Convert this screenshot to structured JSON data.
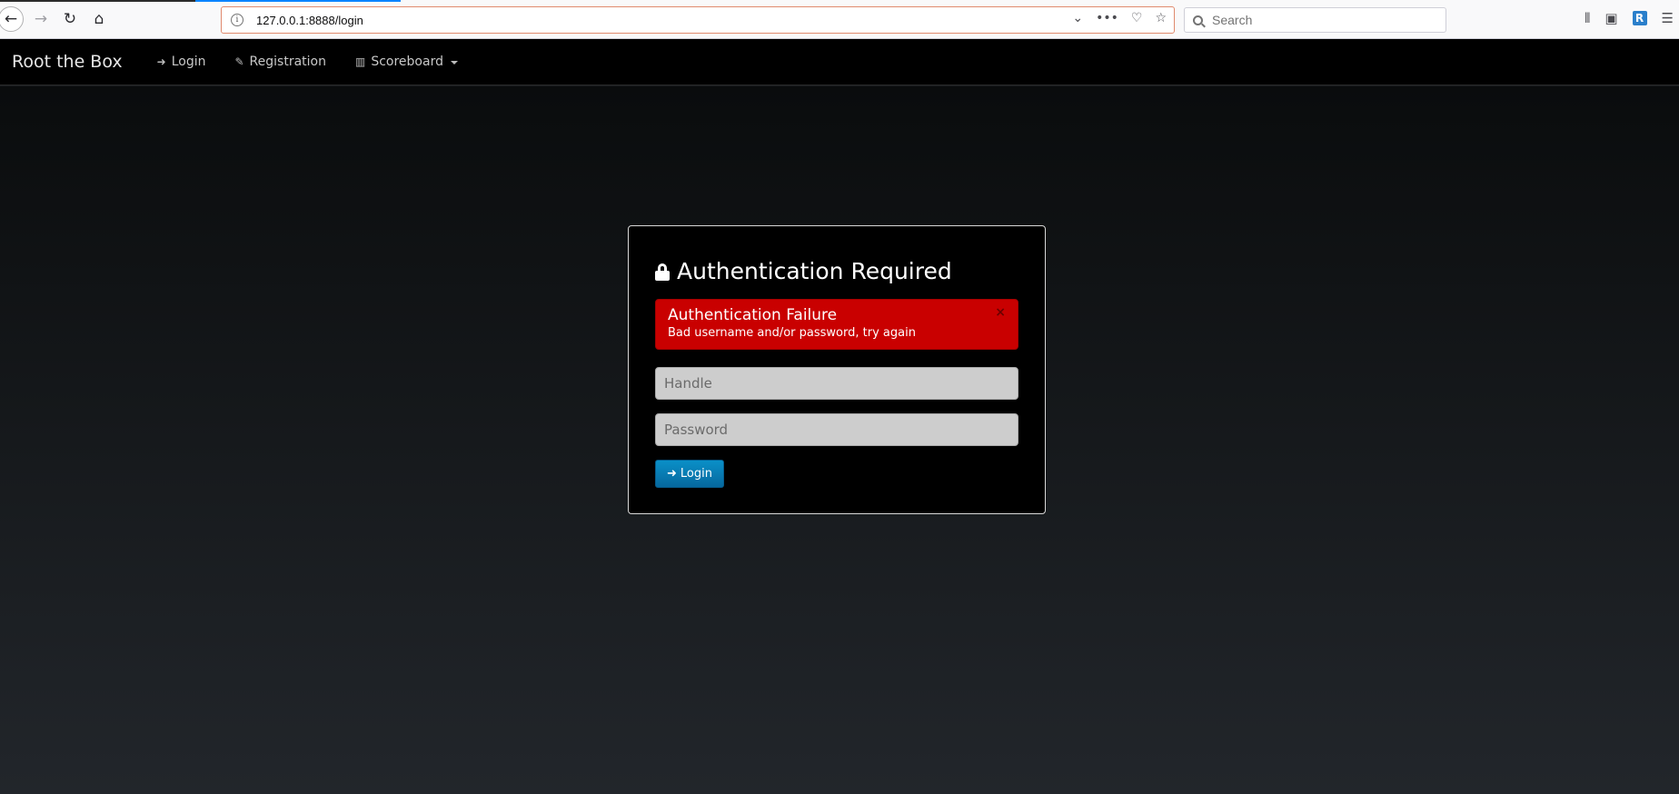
{
  "browser": {
    "url": "127.0.0.1:8888/login",
    "search_placeholder": "Search",
    "profile_badge": "R",
    "icons": [
      "back-icon",
      "forward-icon",
      "reload-icon",
      "home-icon",
      "info-icon",
      "dropdown-icon",
      "more-icon",
      "pocket-icon",
      "bookmark-star-icon",
      "search-icon",
      "library-icon",
      "sidebar-icon",
      "menu-icon"
    ]
  },
  "navbar": {
    "brand": "Root the Box",
    "items": [
      {
        "label": "Login",
        "icon": "sign-in-icon"
      },
      {
        "label": "Registration",
        "icon": "pencil-icon"
      },
      {
        "label": "Scoreboard",
        "icon": "bar-chart-icon"
      }
    ]
  },
  "login_panel": {
    "title": "Authentication Required",
    "title_icon": "lock-icon",
    "alert": {
      "heading": "Authentication Failure",
      "message": "Bad username and/or password, try again",
      "close": "×",
      "color": "#c90000"
    },
    "handle_placeholder": "Handle",
    "password_placeholder": "Password",
    "submit_label": "Login",
    "submit_color": "#0a84ba"
  }
}
